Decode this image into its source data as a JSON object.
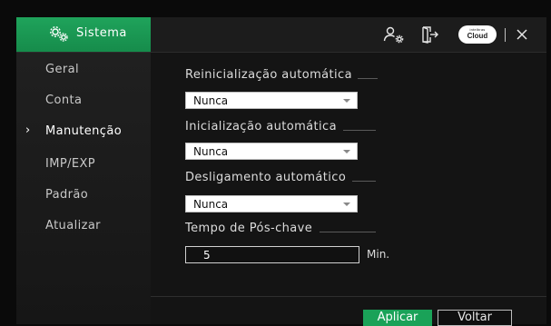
{
  "titlebar": {
    "title": "Sistema",
    "icons": [
      "gears-icon",
      "user-settings-icon",
      "logout-icon",
      "cloud-icon",
      "close-icon"
    ],
    "cloud_brand": "intelbras",
    "cloud_word": "Cloud"
  },
  "sidebar": {
    "items": [
      {
        "label": "Geral"
      },
      {
        "label": "Conta"
      },
      {
        "label": "Manutenção",
        "active": true
      },
      {
        "label": "IMP/EXP"
      },
      {
        "label": "Padrão"
      },
      {
        "label": "Atualizar"
      }
    ],
    "active_marker": "›"
  },
  "main": {
    "reboot": {
      "label": "Reinicialização automática",
      "value": "Nunca"
    },
    "startup": {
      "label": "Inicialização automática",
      "value": "Nunca"
    },
    "shutdown": {
      "label": "Desligamento automático",
      "value": "Nunca"
    },
    "postkey": {
      "label": "Tempo de Pós-chave",
      "value": "5",
      "unit": "Min."
    }
  },
  "footer": {
    "apply_label": "Aplicar",
    "back_label": "Voltar"
  },
  "colors": {
    "accent": "#1aa258",
    "background": "#0a0a0a",
    "panel": "#141414"
  }
}
